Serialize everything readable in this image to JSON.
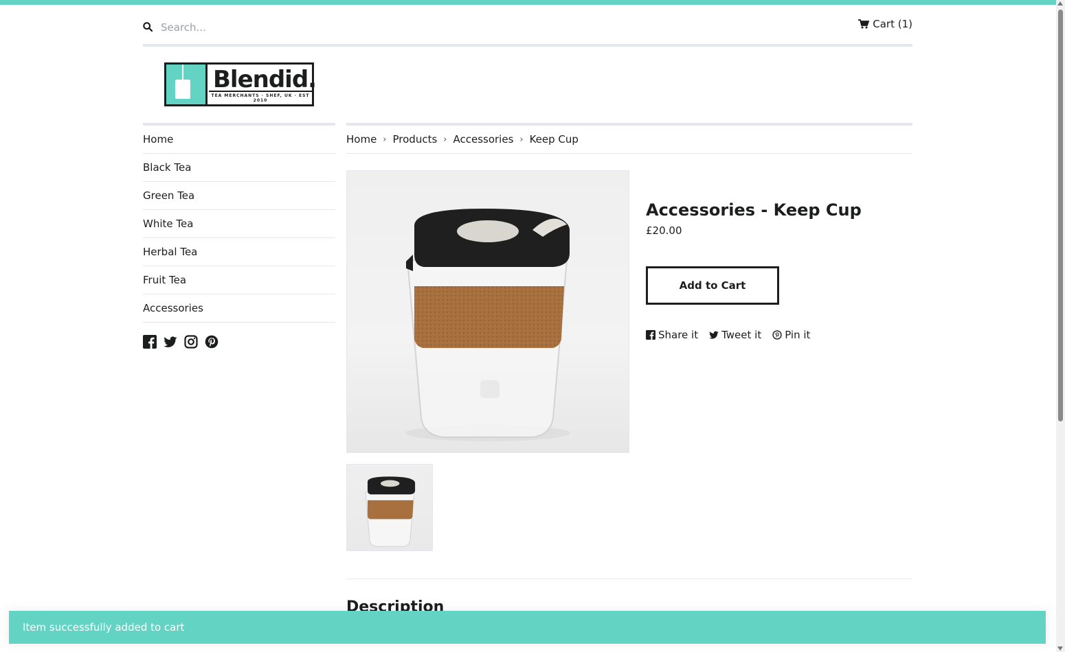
{
  "colors": {
    "accent": "#63d3c4",
    "text": "#1c1d1d",
    "border": "#e4e8ee"
  },
  "header": {
    "search_placeholder": "Search...",
    "cart_label": "Cart (1)"
  },
  "logo": {
    "wordmark": "Blendid.",
    "tagline": "TEA MERCHANTS · SHEF, UK · EST 2010"
  },
  "sidebar": {
    "items": [
      {
        "label": "Home"
      },
      {
        "label": "Black Tea"
      },
      {
        "label": "Green Tea"
      },
      {
        "label": "White Tea"
      },
      {
        "label": "Herbal Tea"
      },
      {
        "label": "Fruit Tea"
      },
      {
        "label": "Accessories"
      }
    ],
    "social_icons": [
      "facebook-icon",
      "twitter-icon",
      "instagram-icon",
      "pinterest-icon"
    ]
  },
  "breadcrumb": [
    "Home",
    "Products",
    "Accessories",
    "Keep Cup"
  ],
  "product": {
    "title": "Accessories - Keep Cup",
    "price": "£20.00",
    "add_to_cart": "Add to Cart",
    "share": {
      "facebook": "Share it",
      "twitter": "Tweet it",
      "pinterest": "Pin it"
    }
  },
  "description_heading": "Description",
  "toast": "Item successfully added to cart"
}
